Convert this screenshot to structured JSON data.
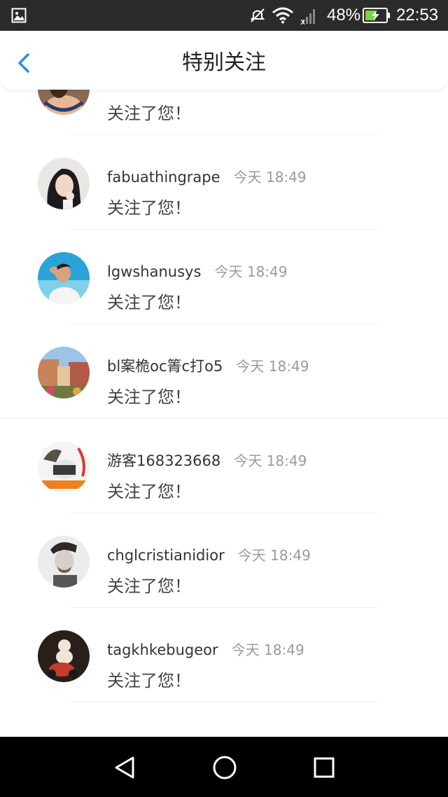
{
  "status_bar": {
    "battery_percent": "48%",
    "time": "22:53",
    "icons": [
      "gallery-icon",
      "mute-icon",
      "wifi-icon",
      "no-signal-icon",
      "battery-charging-icon"
    ]
  },
  "header": {
    "title": "特别关注",
    "back_icon": "chevron-left-icon"
  },
  "notifications": [
    {
      "username": "",
      "time": "",
      "message": "关注了您！"
    },
    {
      "username": "fabuathingrape",
      "time": "今天 18:49",
      "message": "关注了您！"
    },
    {
      "username": "lgwshanusys",
      "time": "今天 18:49",
      "message": "关注了您！"
    },
    {
      "username": "bl案桅oc箐c打o5",
      "time": "今天 18:49",
      "message": "关注了您！"
    },
    {
      "username": "游客168323668",
      "time": "今天 18:49",
      "message": "关注了您！"
    },
    {
      "username": "chglcristianidior",
      "time": "今天 18:49",
      "message": "关注了您！"
    },
    {
      "username": "tagkhkebugeor",
      "time": "今天 18:49",
      "message": "关注了您！"
    }
  ],
  "nav_bar": {
    "buttons": [
      "back-triangle-icon",
      "home-circle-icon",
      "recents-square-icon"
    ]
  },
  "colors": {
    "accent": "#2a8ee6",
    "status_bar_bg": "#2b2b2b",
    "nav_bar_bg": "#000000"
  }
}
